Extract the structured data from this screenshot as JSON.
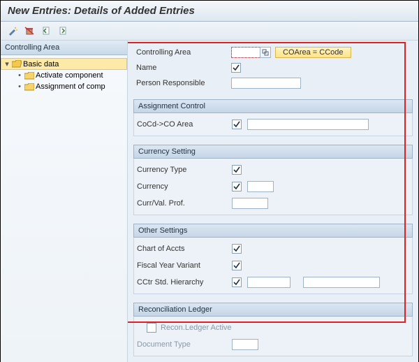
{
  "title": "New Entries: Details of Added Entries",
  "toolbar": {
    "tools": [
      "tool-wand",
      "tool-delete",
      "tool-prev",
      "tool-next"
    ]
  },
  "sidebar": {
    "header": "Controlling Area",
    "root": {
      "label": "Basic data",
      "expanded": true
    },
    "children": [
      {
        "label": "Activate component"
      },
      {
        "label": "Assignment of comp"
      }
    ]
  },
  "form": {
    "controlling_area": {
      "label": "Controlling Area",
      "value": "",
      "badge": "COArea = CCode"
    },
    "name": {
      "label": "Name",
      "checked": true
    },
    "person": {
      "label": "Person Responsible",
      "value": ""
    }
  },
  "groups": {
    "assign": {
      "title": "Assignment Control",
      "cocd": {
        "label": "CoCd->CO Area",
        "checked": true
      }
    },
    "currency": {
      "title": "Currency Setting",
      "ctype": {
        "label": "Currency Type",
        "checked": true
      },
      "curr": {
        "label": "Currency",
        "checked": true,
        "value": ""
      },
      "cvp": {
        "label": "Curr/Val. Prof.",
        "value": ""
      }
    },
    "other": {
      "title": "Other Settings",
      "coa": {
        "label": "Chart of Accts",
        "checked": true
      },
      "fyv": {
        "label": "Fiscal Year Variant",
        "checked": true
      },
      "cctr": {
        "label": "CCtr Std. Hierarchy",
        "checked": true,
        "value": "",
        "value2": ""
      }
    },
    "recon": {
      "title": "Reconciliation Ledger",
      "active": {
        "label": "Recon.Ledger Active",
        "checked": false
      },
      "doctype": {
        "label": "Document Type",
        "value": ""
      }
    }
  }
}
